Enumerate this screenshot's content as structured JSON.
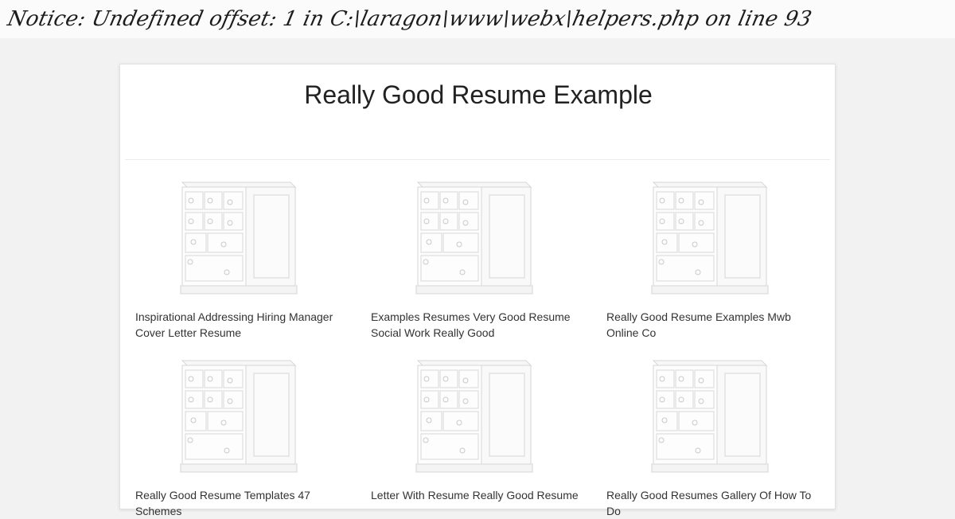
{
  "notice": "Notice: Undefined offset: 1 in C:\\laragon\\www\\webx\\helpers.php on line 93",
  "page_title": "Really Good Resume Example",
  "items": [
    {
      "caption": "Inspirational Addressing Hiring Manager Cover Letter Resume"
    },
    {
      "caption": "Examples Resumes Very Good Resume Social Work Really Good"
    },
    {
      "caption": "Really Good Resume Examples Mwb Online Co"
    },
    {
      "caption": "Really Good Resume Templates 47 Schemes"
    },
    {
      "caption": "Letter With Resume Really Good Resume"
    },
    {
      "caption": "Really Good Resumes Gallery Of How To Do"
    }
  ],
  "thumbnail_icon": "dresser-image"
}
